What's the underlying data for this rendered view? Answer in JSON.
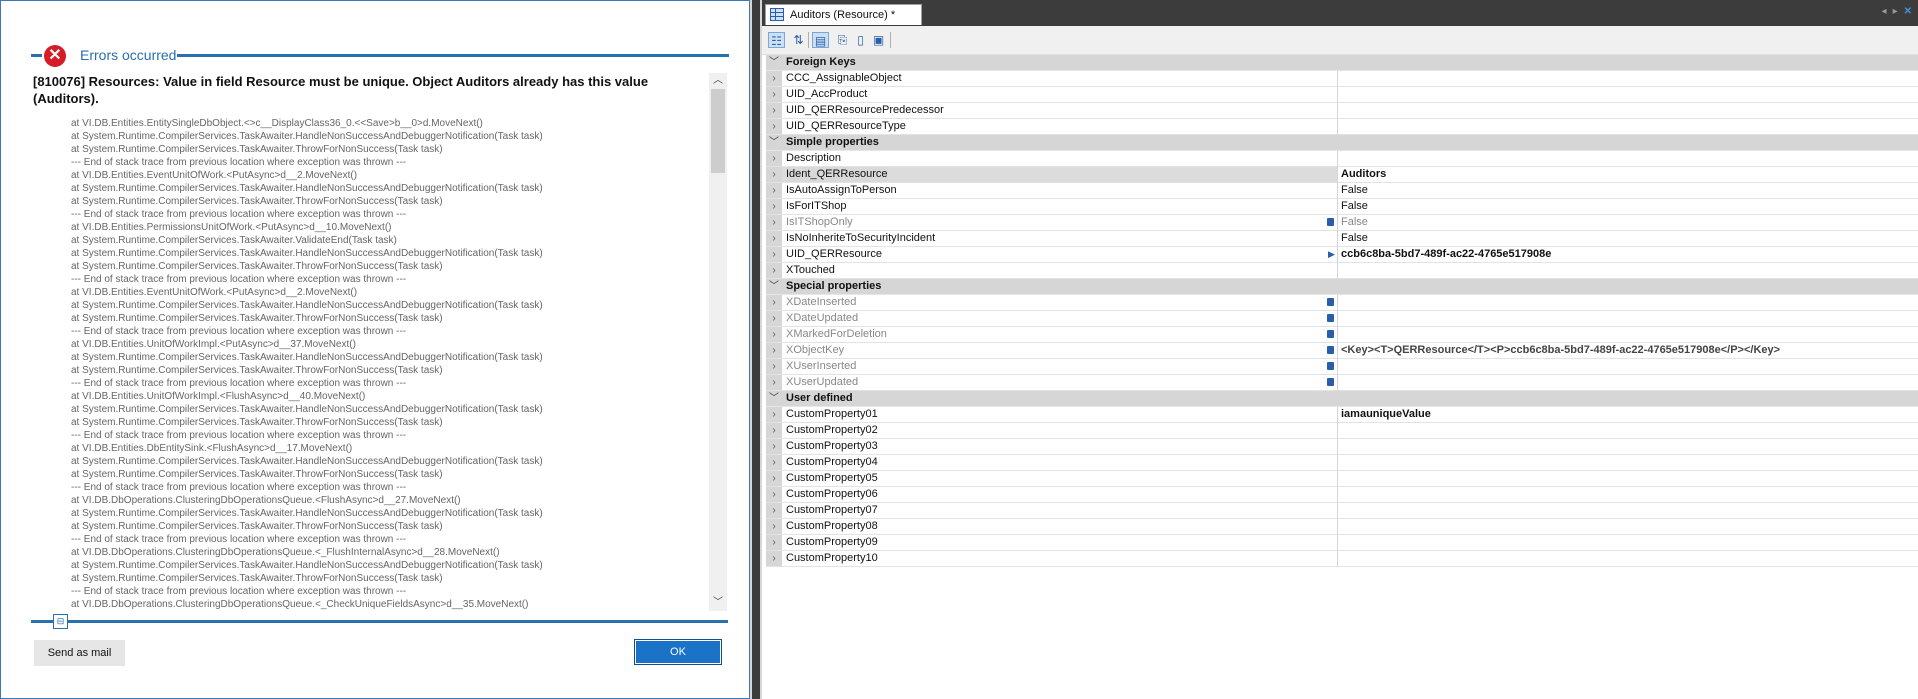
{
  "dialog": {
    "header_title": "Errors occurred",
    "message": "[810076] Resources: Value in field Resource must be unique. Object Auditors already has this value (Auditors).",
    "stack_trace": [
      "at VI.DB.Entities.EntitySingleDbObject.<>c__DisplayClass36_0.<<Save>b__0>d.MoveNext()",
      "at System.Runtime.CompilerServices.TaskAwaiter.HandleNonSuccessAndDebuggerNotification(Task task)",
      "at System.Runtime.CompilerServices.TaskAwaiter.ThrowForNonSuccess(Task task)",
      "--- End of stack trace from previous location where exception was thrown ---",
      "at VI.DB.Entities.EventUnitOfWork.<PutAsync>d__2.MoveNext()",
      "at System.Runtime.CompilerServices.TaskAwaiter.HandleNonSuccessAndDebuggerNotification(Task task)",
      "at System.Runtime.CompilerServices.TaskAwaiter.ThrowForNonSuccess(Task task)",
      "--- End of stack trace from previous location where exception was thrown ---",
      "at VI.DB.Entities.PermissionsUnitOfWork.<PutAsync>d__10.MoveNext()",
      "at System.Runtime.CompilerServices.TaskAwaiter.ValidateEnd(Task task)",
      "at System.Runtime.CompilerServices.TaskAwaiter.HandleNonSuccessAndDebuggerNotification(Task task)",
      "at System.Runtime.CompilerServices.TaskAwaiter.ThrowForNonSuccess(Task task)",
      "--- End of stack trace from previous location where exception was thrown ---",
      "at VI.DB.Entities.EventUnitOfWork.<PutAsync>d__2.MoveNext()",
      "at System.Runtime.CompilerServices.TaskAwaiter.HandleNonSuccessAndDebuggerNotification(Task task)",
      "at System.Runtime.CompilerServices.TaskAwaiter.ThrowForNonSuccess(Task task)",
      "--- End of stack trace from previous location where exception was thrown ---",
      "at VI.DB.Entities.UnitOfWorkImpl.<PutAsync>d__37.MoveNext()",
      "at System.Runtime.CompilerServices.TaskAwaiter.HandleNonSuccessAndDebuggerNotification(Task task)",
      "at System.Runtime.CompilerServices.TaskAwaiter.ThrowForNonSuccess(Task task)",
      "--- End of stack trace from previous location where exception was thrown ---",
      "at VI.DB.Entities.UnitOfWorkImpl.<FlushAsync>d__40.MoveNext()",
      "at System.Runtime.CompilerServices.TaskAwaiter.HandleNonSuccessAndDebuggerNotification(Task task)",
      "at System.Runtime.CompilerServices.TaskAwaiter.ThrowForNonSuccess(Task task)",
      "--- End of stack trace from previous location where exception was thrown ---",
      "at VI.DB.Entities.DbEntitySink.<FlushAsync>d__17.MoveNext()",
      "at System.Runtime.CompilerServices.TaskAwaiter.HandleNonSuccessAndDebuggerNotification(Task task)",
      "at System.Runtime.CompilerServices.TaskAwaiter.ThrowForNonSuccess(Task task)",
      "--- End of stack trace from previous location where exception was thrown ---",
      "at VI.DB.DbOperations.ClusteringDbOperationsQueue.<FlushAsync>d__27.MoveNext()",
      "at System.Runtime.CompilerServices.TaskAwaiter.HandleNonSuccessAndDebuggerNotification(Task task)",
      "at System.Runtime.CompilerServices.TaskAwaiter.ThrowForNonSuccess(Task task)",
      "--- End of stack trace from previous location where exception was thrown ---",
      "at VI.DB.DbOperations.ClusteringDbOperationsQueue.<_FlushInternalAsync>d__28.MoveNext()",
      "at System.Runtime.CompilerServices.TaskAwaiter.HandleNonSuccessAndDebuggerNotification(Task task)",
      "at System.Runtime.CompilerServices.TaskAwaiter.ThrowForNonSuccess(Task task)",
      "--- End of stack trace from previous location where exception was thrown ---",
      "at VI.DB.DbOperations.ClusteringDbOperationsQueue.<_CheckUniqueFieldsAsync>d__35.MoveNext()"
    ],
    "send_mail_label": "Send as mail",
    "ok_label": "OK",
    "icons": {
      "error": "error-circle-icon",
      "expand": "expand-icon"
    }
  },
  "tab": {
    "title": "Auditors (Resource) *",
    "icon": "table-icon"
  },
  "toolbar": {
    "buttons": [
      {
        "name": "categorized-view-icon",
        "glyph": "☷",
        "active": true
      },
      {
        "name": "sort-alphabetical-icon",
        "glyph": "⇅",
        "active": false
      },
      {
        "name": "property-page-icon",
        "glyph": "▤",
        "active": true
      },
      {
        "name": "relations-icon",
        "glyph": "⎘",
        "active": false
      },
      {
        "name": "document-icon",
        "glyph": "▯",
        "active": false
      },
      {
        "name": "preview-icon",
        "glyph": "▣",
        "active": false
      }
    ]
  },
  "categories": [
    {
      "label": "Foreign Keys",
      "rows": [
        {
          "name": "CCC_AssignableObject",
          "value": ""
        },
        {
          "name": "UID_AccProduct",
          "value": ""
        },
        {
          "name": "UID_QERResourcePredecessor",
          "value": ""
        },
        {
          "name": "UID_QERResourceType",
          "value": ""
        }
      ]
    },
    {
      "label": "Simple properties",
      "rows": [
        {
          "name": "Description",
          "value": ""
        },
        {
          "name": "Ident_QERResource",
          "value": "Auditors",
          "bold": true,
          "selected": true
        },
        {
          "name": "IsAutoAssignToPerson",
          "value": "False"
        },
        {
          "name": "IsForITShop",
          "value": "False"
        },
        {
          "name": "IsITShopOnly",
          "value": "False",
          "readonly": true,
          "lock": true
        },
        {
          "name": "IsNoInheriteToSecurityIncident",
          "value": "False"
        },
        {
          "name": "UID_QERResource",
          "value": "ccb6c8ba-5bd7-489f-ac22-4765e517908e",
          "bold": true,
          "arrow": true
        },
        {
          "name": "XTouched",
          "value": ""
        }
      ]
    },
    {
      "label": "Special properties",
      "rows": [
        {
          "name": "XDateInserted",
          "value": "",
          "readonly": true,
          "lock": true
        },
        {
          "name": "XDateUpdated",
          "value": "",
          "readonly": true,
          "lock": true
        },
        {
          "name": "XMarkedForDeletion",
          "value": "",
          "readonly": true,
          "lock": true
        },
        {
          "name": "XObjectKey",
          "value": "<Key><T>QERResource</T><P>ccb6c8ba-5bd7-489f-ac22-4765e517908e</P></Key>",
          "readonly": true,
          "lock": true,
          "bold": true,
          "dim": true
        },
        {
          "name": "XUserInserted",
          "value": "",
          "readonly": true,
          "lock": true
        },
        {
          "name": "XUserUpdated",
          "value": "",
          "readonly": true,
          "lock": true
        }
      ]
    },
    {
      "label": "User defined",
      "rows": [
        {
          "name": "CustomProperty01",
          "value": "iamauniqueValue",
          "bold": true
        },
        {
          "name": "CustomProperty02",
          "value": ""
        },
        {
          "name": "CustomProperty03",
          "value": ""
        },
        {
          "name": "CustomProperty04",
          "value": ""
        },
        {
          "name": "CustomProperty05",
          "value": ""
        },
        {
          "name": "CustomProperty06",
          "value": ""
        },
        {
          "name": "CustomProperty07",
          "value": ""
        },
        {
          "name": "CustomProperty08",
          "value": ""
        },
        {
          "name": "CustomProperty09",
          "value": ""
        },
        {
          "name": "CustomProperty10",
          "value": ""
        }
      ]
    }
  ],
  "colors": {
    "accent": "#2a6fb0",
    "error": "#d51c27",
    "ok_button": "#1a73c6",
    "category_bg": "#d6d6d6",
    "dark_chrome": "#3c3c3c"
  }
}
